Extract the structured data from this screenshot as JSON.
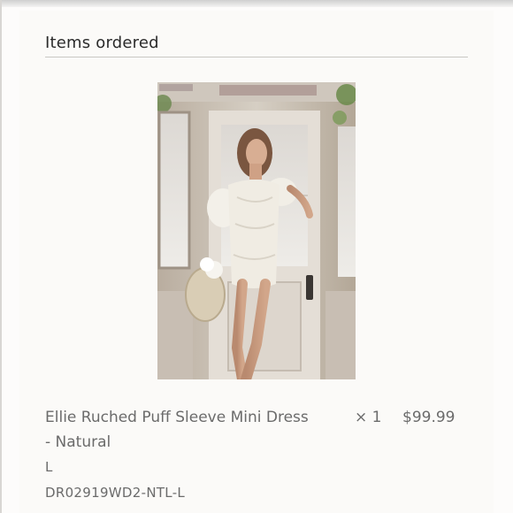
{
  "order": {
    "section_title": "Items ordered"
  },
  "items": [
    {
      "image_alt": "Woman wearing white off-shoulder ruched mini dress standing in doorway",
      "name": "Ellie Ruched Puff Sleeve Mini Dress - Natural",
      "quantity": "× 1",
      "price": "$99.99",
      "variant": "L",
      "sku": "DR02919WD2-NTL-L"
    }
  ],
  "colors": {
    "title_text": "#2b2b2b",
    "body_text": "#6b6b6b",
    "divider": "#c9c7c4",
    "background": "#fbfaf8"
  }
}
